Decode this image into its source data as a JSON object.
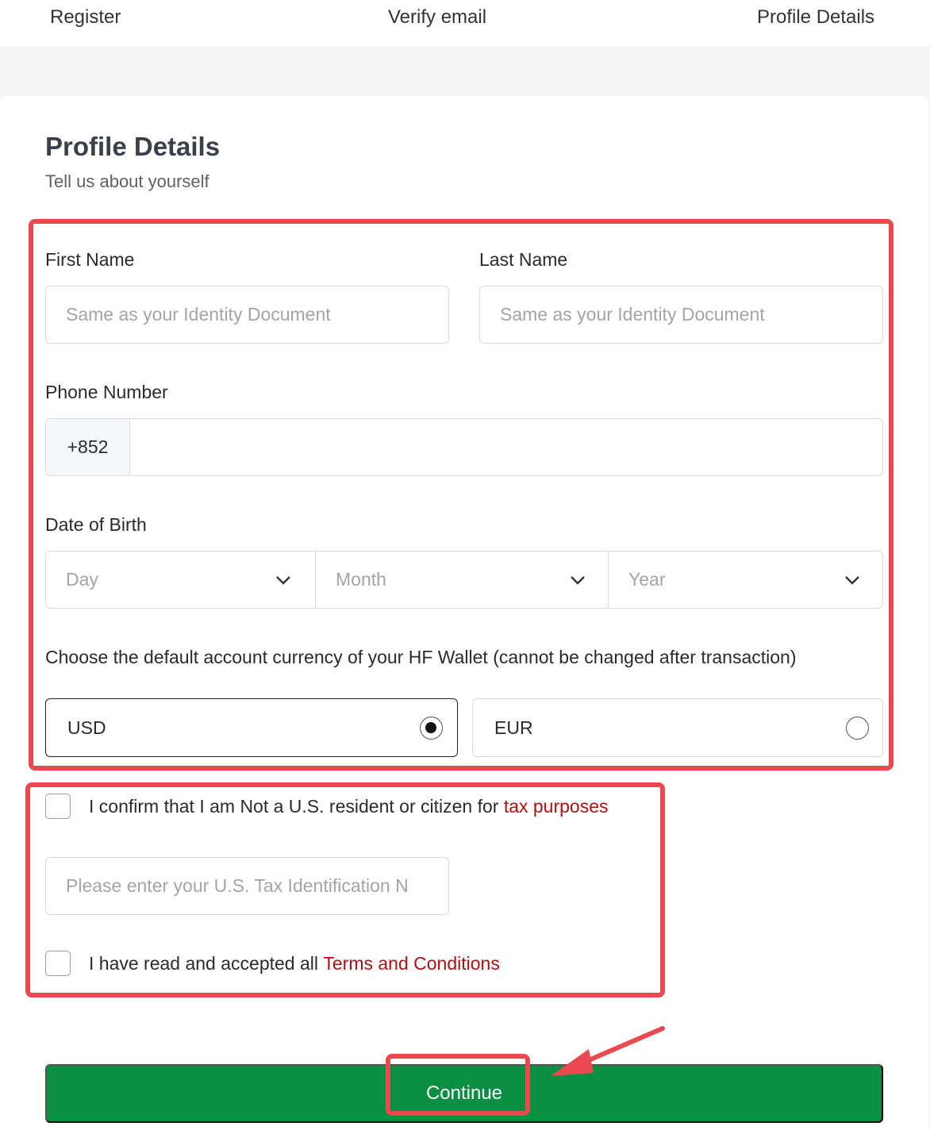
{
  "steps": [
    "Register",
    "Verify email",
    "Profile Details"
  ],
  "header": {
    "title": "Profile Details",
    "subtitle": "Tell us about yourself"
  },
  "form": {
    "first_name": {
      "label": "First Name",
      "placeholder": "Same as your Identity Document"
    },
    "last_name": {
      "label": "Last Name",
      "placeholder": "Same as your Identity Document"
    },
    "phone": {
      "label": "Phone Number",
      "country_code": "+852",
      "value": ""
    },
    "dob": {
      "label": "Date of Birth",
      "day": "Day",
      "month": "Month",
      "year": "Year"
    },
    "currency": {
      "label": "Choose the default account currency of your HF Wallet (cannot be changed after transaction)",
      "options": [
        {
          "label": "USD",
          "selected": true
        },
        {
          "label": "EUR",
          "selected": false
        }
      ]
    },
    "tax_confirm": {
      "text": "I confirm that I am Not a U.S. resident or citizen for ",
      "link": "tax purposes",
      "checked": false
    },
    "tax_id": {
      "placeholder": "Please enter your U.S. Tax Identification N"
    },
    "terms": {
      "text": "I have read and accepted all ",
      "link": "Terms and Conditions",
      "checked": false
    },
    "continue_label": "Continue"
  },
  "colors": {
    "accent_green": "#0a8f43",
    "link_red": "#b10f12",
    "annotation_red": "#ea4a4f"
  }
}
